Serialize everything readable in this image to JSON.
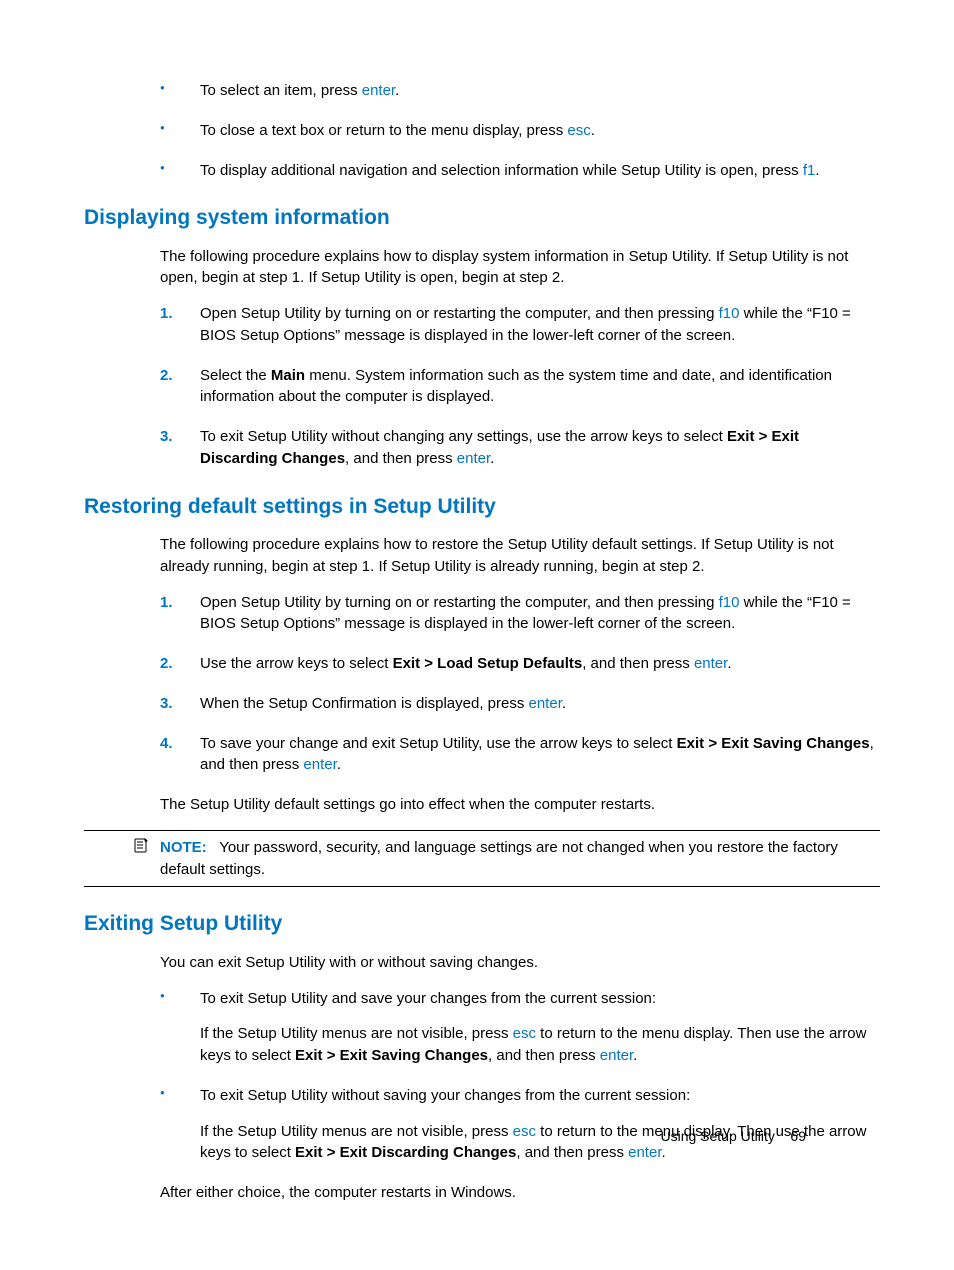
{
  "topBullets": {
    "items": [
      {
        "pre": "To select an item, press ",
        "key": "enter",
        "post": "."
      },
      {
        "pre": "To close a text box or return to the menu display, press ",
        "key": "esc",
        "post": "."
      },
      {
        "pre": "To display additional navigation and selection information while Setup Utility is open, press ",
        "key": "f1",
        "post": "."
      }
    ]
  },
  "sec1": {
    "heading": "Displaying system information",
    "intro": "The following procedure explains how to display system information in Setup Utility. If Setup Utility is not open, begin at step 1. If Setup Utility is open, begin at step 2.",
    "steps": {
      "s1": {
        "num": "1.",
        "a": "Open Setup Utility by turning on or restarting the computer, and then pressing ",
        "key": "f10",
        "b": " while the “F10 = BIOS Setup Options” message is displayed in the lower-left corner of the screen."
      },
      "s2": {
        "num": "2.",
        "a": "Select the ",
        "bold": "Main",
        "b": " menu. System information such as the system time and date, and identification information about the computer is displayed."
      },
      "s3": {
        "num": "3.",
        "a": "To exit Setup Utility without changing any settings, use the arrow keys to select ",
        "bold": "Exit > Exit Discarding Changes",
        "b": ", and then press ",
        "key": "enter",
        "c": "."
      }
    }
  },
  "sec2": {
    "heading": "Restoring default settings in Setup Utility",
    "intro": "The following procedure explains how to restore the Setup Utility default settings. If Setup Utility is not already running, begin at step 1. If Setup Utility is already running, begin at step 2.",
    "steps": {
      "s1": {
        "num": "1.",
        "a": "Open Setup Utility by turning on or restarting the computer, and then pressing ",
        "key": "f10",
        "b": " while the “F10 = BIOS Setup Options” message is displayed in the lower-left corner of the screen."
      },
      "s2": {
        "num": "2.",
        "a": "Use the arrow keys to select ",
        "bold": "Exit > Load Setup Defaults",
        "b": ", and then press ",
        "key": "enter",
        "c": "."
      },
      "s3": {
        "num": "3.",
        "a": "When the Setup Confirmation is displayed, press ",
        "key": "enter",
        "b": "."
      },
      "s4": {
        "num": "4.",
        "a": "To save your change and exit Setup Utility, use the arrow keys to select ",
        "bold": "Exit > Exit Saving Changes",
        "b": ", and then press ",
        "key": "enter",
        "c": "."
      }
    },
    "outro": "The Setup Utility default settings go into effect when the computer restarts.",
    "note": {
      "label": "NOTE:",
      "text": "Your password, security, and language settings are not changed when you restore the factory default settings."
    }
  },
  "sec3": {
    "heading": "Exiting Setup Utility",
    "intro": "You can exit Setup Utility with or without saving changes.",
    "bullets": {
      "b1": {
        "head": "To exit Setup Utility and save your changes from the current session:",
        "body": {
          "a": "If the Setup Utility menus are not visible, press ",
          "k1": "esc",
          "b": " to return to the menu display. Then use the arrow keys to select ",
          "bold": "Exit > Exit Saving Changes",
          "c": ", and then press ",
          "k2": "enter",
          "d": "."
        }
      },
      "b2": {
        "head": "To exit Setup Utility without saving your changes from the current session:",
        "body": {
          "a": "If the Setup Utility menus are not visible, press ",
          "k1": "esc",
          "b": " to return to the menu display. Then use the arrow keys to select ",
          "bold": "Exit > Exit Discarding Changes",
          "c": ", and then press ",
          "k2": "enter",
          "d": "."
        }
      }
    },
    "outro": "After either choice, the computer restarts in Windows."
  },
  "footer": {
    "text": "Using Setup Utility",
    "page": "69"
  }
}
